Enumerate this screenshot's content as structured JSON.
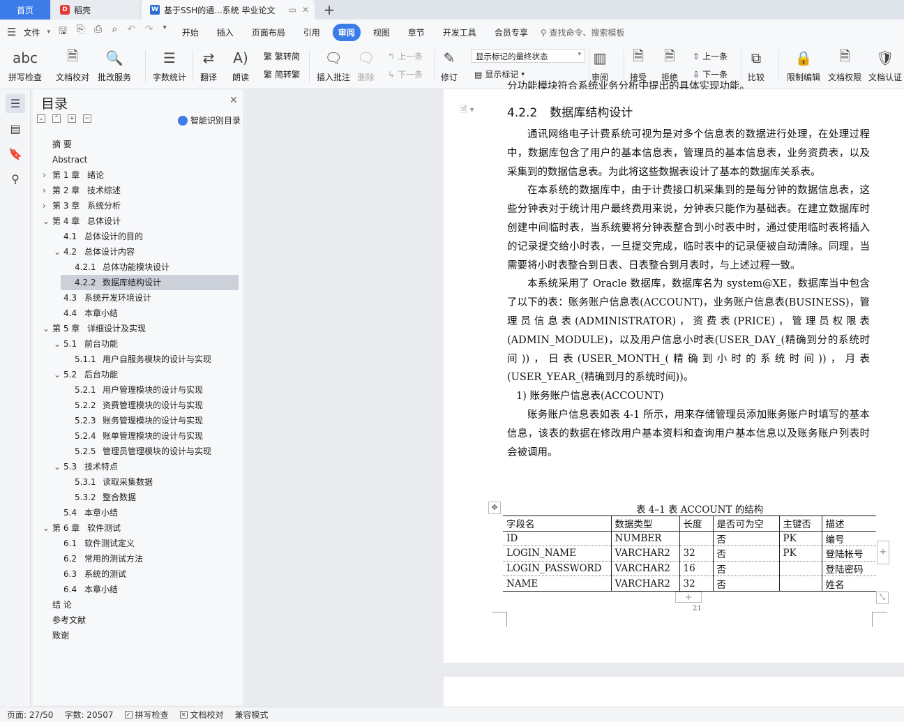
{
  "tabs": {
    "home": "首页",
    "daoke": "稻壳",
    "doc": "基于SSH的通...系统 毕业论文",
    "add": "+"
  },
  "menu": {
    "file": "文件",
    "items": [
      "开始",
      "插入",
      "页面布局",
      "引用",
      "审阅",
      "视图",
      "章节",
      "开发工具",
      "会员专享"
    ],
    "active": "审阅",
    "search": "查找命令、搜索模板"
  },
  "ribbon": {
    "spell": "拼写检查",
    "proof": "文档校对",
    "batch": "批改服务",
    "wordcount": "字数统计",
    "translate": "翻译",
    "read": "朗读",
    "trad2simp": "繁转简",
    "simp2trad": "简转繁",
    "insert_comment": "插入批注",
    "delete": "删除",
    "prev": "上一条",
    "next": "下一条",
    "revise": "修订",
    "display_select": "显示标记的最终状态",
    "show_markup": "显示标记",
    "review": "审阅",
    "accept": "接受",
    "reject": "拒绝",
    "prev2": "上一条",
    "next2": "下一条",
    "compare": "比较",
    "restrict": "限制编辑",
    "permission": "文档权限",
    "certify": "文档认证"
  },
  "toc": {
    "title": "目录",
    "smart": "智能识别目录",
    "items": [
      {
        "num": "摘  要",
        "text": ""
      },
      {
        "num": "Abstract",
        "text": ""
      },
      {
        "num": "第 1 章",
        "text": "绪论"
      },
      {
        "num": "第 2 章",
        "text": "技术综述"
      },
      {
        "num": "第 3 章",
        "text": "系统分析"
      },
      {
        "num": "第 4 章",
        "text": "总体设计"
      },
      {
        "num": "4.1",
        "text": "总体设计的目的"
      },
      {
        "num": "4.2",
        "text": "总体设计内容"
      },
      {
        "num": "4.2.1",
        "text": "总体功能模块设计"
      },
      {
        "num": "4.2.2",
        "text": "数据库结构设计"
      },
      {
        "num": "4.3",
        "text": "系统开发环境设计"
      },
      {
        "num": "4.4",
        "text": "本章小结"
      },
      {
        "num": "第 5 章",
        "text": "详细设计及实现"
      },
      {
        "num": "5.1",
        "text": "前台功能"
      },
      {
        "num": "5.1.1",
        "text": "用户自服务模块的设计与实现"
      },
      {
        "num": "5.2",
        "text": "后台功能"
      },
      {
        "num": "5.2.1",
        "text": "用户管理模块的设计与实现"
      },
      {
        "num": "5.2.2",
        "text": "资费管理模块的设计与实现"
      },
      {
        "num": "5.2.3",
        "text": "账务管理模块的设计与实现"
      },
      {
        "num": "5.2.4",
        "text": "账单管理模块的设计与实现"
      },
      {
        "num": "5.2.5",
        "text": "管理员管理模块的设计与实现"
      },
      {
        "num": "5.3",
        "text": "技术特点"
      },
      {
        "num": "5.3.1",
        "text": "读取采集数据"
      },
      {
        "num": "5.3.2",
        "text": "整合数据"
      },
      {
        "num": "5.4",
        "text": "本章小结"
      },
      {
        "num": "第 6 章",
        "text": "软件测试"
      },
      {
        "num": "6.1",
        "text": "软件测试定义"
      },
      {
        "num": "6.2",
        "text": "常用的测试方法"
      },
      {
        "num": "6.3",
        "text": "系统的测试"
      },
      {
        "num": "6.4",
        "text": "本章小结"
      },
      {
        "num": "结  论",
        "text": ""
      },
      {
        "num": "参考文献",
        "text": ""
      },
      {
        "num": "致谢",
        "text": ""
      }
    ]
  },
  "doc": {
    "cut_line": "分功能模块符合系统业务分析中提出的具体实现功能。",
    "heading_num": "4.2.2",
    "heading_text": "数据库结构设计",
    "p1": "通讯网络电子计费系统可视为是对多个信息表的数据进行处理，在处理过程中，数据库包含了用户的基本信息表，管理员的基本信息表，业务资费表，以及采集到的数据信息表。为此将这些数据表设计了基本的数据库关系表。",
    "p2": "在本系统的数据库中，由于计费接口机采集到的是每分钟的数据信息表，这些分钟表对于统计用户最终费用来说，分钟表只能作为基础表。在建立数据库时创建中间临时表，当系统要将分钟表整合到小时表中时，通过使用临时表将插入的记录提交给小时表，一旦提交完成，临时表中的记录便被自动清除。同理，当需要将小时表整合到日表、日表整合到月表时，与上述过程一致。",
    "p3": "本系统采用了 Oracle 数据库，数据库名为 system@XE，数据库当中包含了以下的表：账务账户信息表(ACCOUNT)，业务账户信息表(BUSINESS)，管理员信息表(ADMINISTRATOR)，资费表(PRICE)，管理员权限表(ADMIN_MODULE)，以及用户信息小时表(USER_DAY_(精确到分的系统时间))，日表(USER_MONTH_(精确到小时的系统时间))，月表(USER_YEAR_(精确到月的系统时间))。",
    "li1": "1)  账务账户信息表(ACCOUNT)",
    "p4": "账务账户信息表如表 4-1 所示，用来存储管理员添加账务账户时填写的基本信息，该表的数据在修改用户基本资料和查询用户基本信息以及账务账户列表时会被调用。",
    "table_caption": "表 4–1   表 ACCOUNT 的结构",
    "table_head": [
      "字段名",
      "数据类型",
      "长度",
      "是否可为空",
      "主键否",
      "描述"
    ],
    "table_rows": [
      [
        "ID",
        "NUMBER",
        "",
        "否",
        "PK",
        "编号"
      ],
      [
        "LOGIN_NAME",
        "VARCHAR2",
        "32",
        "否",
        "PK",
        "登陆帐号"
      ],
      [
        "LOGIN_PASSWORD",
        "VARCHAR2",
        "16",
        "否",
        "",
        "登陆密码"
      ],
      [
        "NAME",
        "VARCHAR2",
        "32",
        "否",
        "",
        "姓名"
      ]
    ],
    "page_number": "21"
  },
  "status": {
    "page": "页面: 27/50",
    "words": "字数: 20507",
    "spell": "拼写检查",
    "proof": "文档校对",
    "compat": "兼容模式"
  }
}
